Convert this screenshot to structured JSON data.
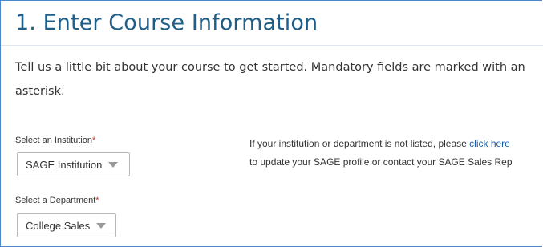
{
  "header": {
    "title": "1. Enter Course Information"
  },
  "intro": {
    "text": "Tell us a little bit about your course to get started. Mandatory fields are marked with an asterisk."
  },
  "institution": {
    "label": "Select an Institution",
    "required_mark": "*",
    "selected": "SAGE Institution"
  },
  "department": {
    "label": "Select a Department",
    "required_mark": "*",
    "selected": "College Sales"
  },
  "help_note": {
    "line1_prefix": "If your institution or department is not listed, please ",
    "link_text": "click here",
    "line2": "to update your SAGE profile or contact your SAGE Sales Rep"
  },
  "colors": {
    "title": "#1d5f8a",
    "link": "#1a5fa8",
    "required": "#c0392b",
    "frame_border": "#4a86c8"
  }
}
